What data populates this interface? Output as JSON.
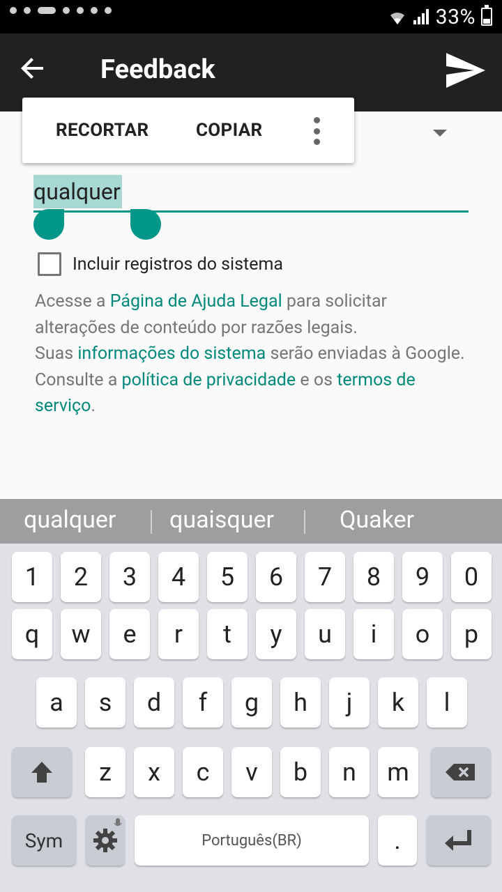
{
  "status_bar": {
    "battery_percent": "33%",
    "battery_level": 0.33
  },
  "app_bar": {
    "title": "Feedback",
    "back_icon": "arrow-left-icon",
    "send_icon": "send-icon"
  },
  "selection_toolbar": {
    "cut_label": "RECORTAR",
    "copy_label": "COPIAR",
    "more_icon": "more-vert-icon"
  },
  "feedback_field": {
    "value": "qualquer"
  },
  "system_logs": {
    "label": "Incluir registros do sistema",
    "checked": false
  },
  "legal": {
    "t1": "Acesse a ",
    "l1": "Página de Ajuda Legal",
    "t2": " para solicitar alterações de conteúdo por razões legais.",
    "t3": "Suas ",
    "l2": "informações do sistema",
    "t4": " serão enviadas à Google. Consulte a ",
    "l3": "política de privacidade",
    "t5": " e os ",
    "l4": "termos de serviço",
    "t6": "."
  },
  "keyboard": {
    "suggestions": [
      "qualquer",
      "quaisquer",
      "Quaker"
    ],
    "row_numbers": [
      "1",
      "2",
      "3",
      "4",
      "5",
      "6",
      "7",
      "8",
      "9",
      "0"
    ],
    "row1": [
      "q",
      "w",
      "e",
      "r",
      "t",
      "y",
      "u",
      "i",
      "o",
      "p"
    ],
    "row2": [
      "a",
      "s",
      "d",
      "f",
      "g",
      "h",
      "j",
      "k",
      "l"
    ],
    "row3": [
      "z",
      "x",
      "c",
      "v",
      "b",
      "n",
      "m"
    ],
    "sym_label": "Sym",
    "space_label": "Português(BR)",
    "period_label": ".",
    "shift_icon": "shift-arrow-icon",
    "backspace_icon": "backspace-icon",
    "settings_icon": "gear-icon",
    "mic_icon": "mic-icon",
    "enter_icon": "enter-icon"
  }
}
